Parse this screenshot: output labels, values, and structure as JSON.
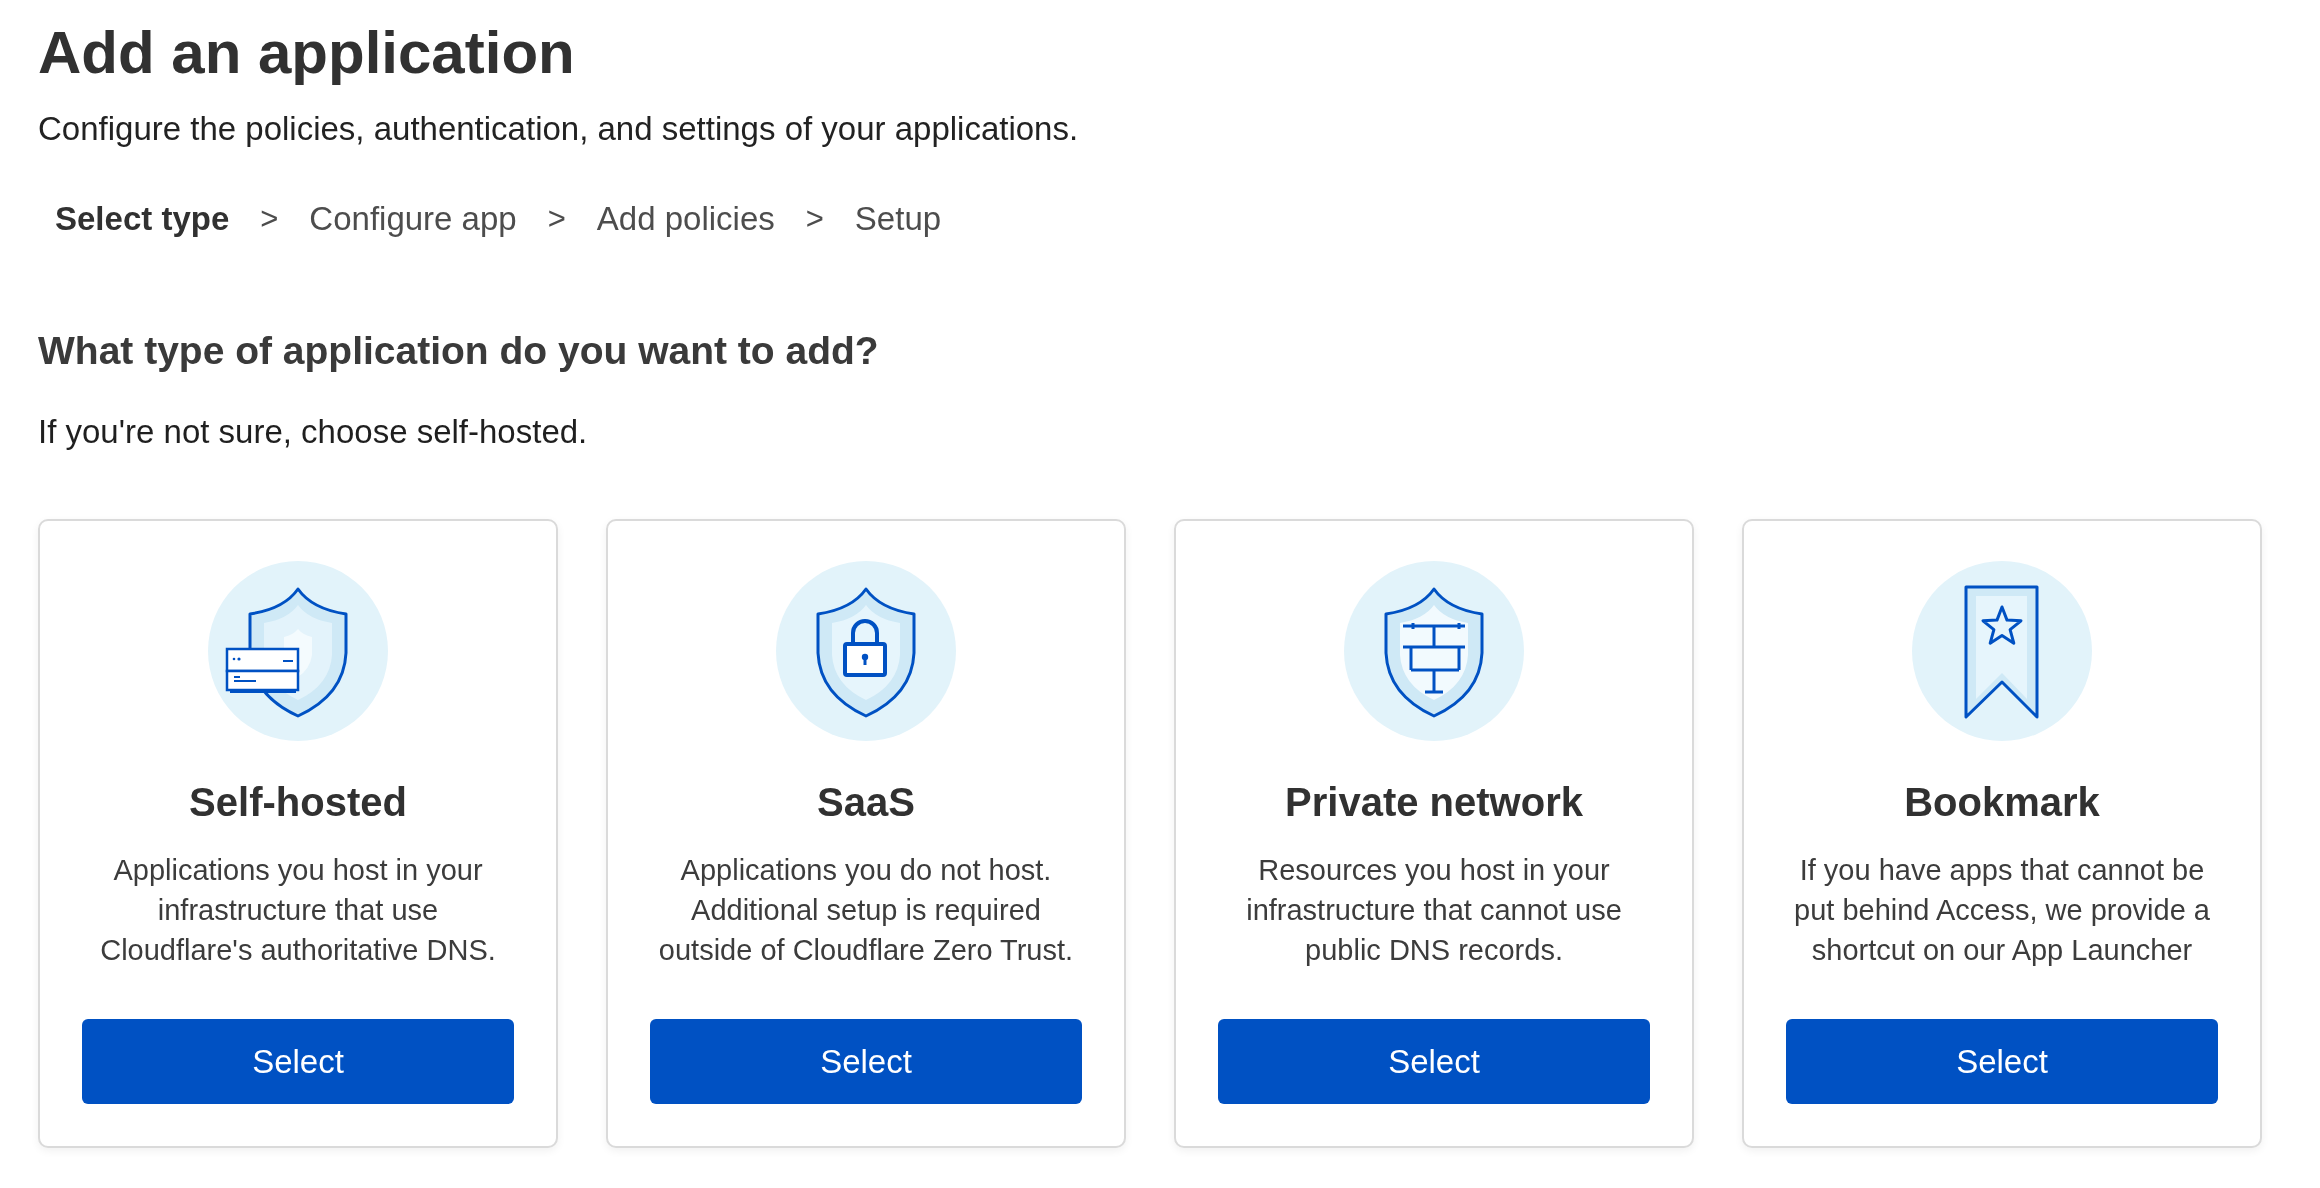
{
  "page": {
    "title": "Add an application",
    "subtitle": "Configure the policies, authentication, and settings of your applications."
  },
  "steps": [
    {
      "label": "Select type",
      "selected": true
    },
    {
      "separator": ">",
      "label": "Configure app",
      "selected": false
    },
    {
      "separator": ">",
      "label": "Add policies",
      "selected": false
    },
    {
      "separator": ">",
      "label": "Setup",
      "selected": false
    }
  ],
  "question": {
    "title": "What type of application do you want to add?",
    "hint": "If you're not sure, choose self-hosted."
  },
  "app_types": [
    {
      "kind": "selfhosted",
      "name": "Self-hosted",
      "description": "Applications you host in your infrastructure that use Cloudflare's authoritative DNS.",
      "button": "Select"
    },
    {
      "kind": "saas",
      "name": "SaaS",
      "description": "Applications you do not host. Additional setup is required outside of Cloudflare Zero Trust.",
      "button": "Select"
    },
    {
      "kind": "network",
      "name": "Private network",
      "description": "Resources you host in your infrastructure that cannot use public DNS records.",
      "button": "Select"
    },
    {
      "kind": "bookmark",
      "name": "Bookmark",
      "description": "If you have apps that cannot be put behind Access, we provide a shortcut on our App Launcher",
      "button": "Select"
    }
  ]
}
